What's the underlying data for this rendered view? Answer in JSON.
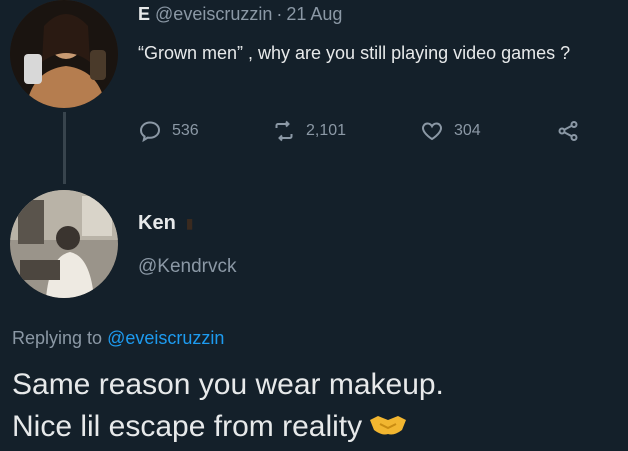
{
  "tweet1": {
    "name": "E",
    "handle": "@eveiscruzzin",
    "separator": "·",
    "date": "21 Aug",
    "text": "“Grown men” , why are you still playing video games ?",
    "stats": {
      "replies": "536",
      "retweets": "2,101",
      "likes": "304"
    }
  },
  "tweet2": {
    "name": "Ken",
    "handle": "@Kendrvck",
    "replying_prefix": "Replying to",
    "replying_to": "@eveiscruzzin",
    "line1": "Same reason you wear makeup.",
    "line2": "Nice lil escape from reality",
    "emoji": "handshake-emoji"
  },
  "icons": {
    "reply": "reply-icon",
    "retweet": "retweet-icon",
    "like": "heart-icon",
    "share": "share-icon"
  },
  "colors": {
    "background": "#14202a",
    "text": "#e7e9ea",
    "muted": "#8b98a5",
    "link": "#1d9bf0",
    "thread_line": "#38444d",
    "emoji": "#f2b630"
  }
}
